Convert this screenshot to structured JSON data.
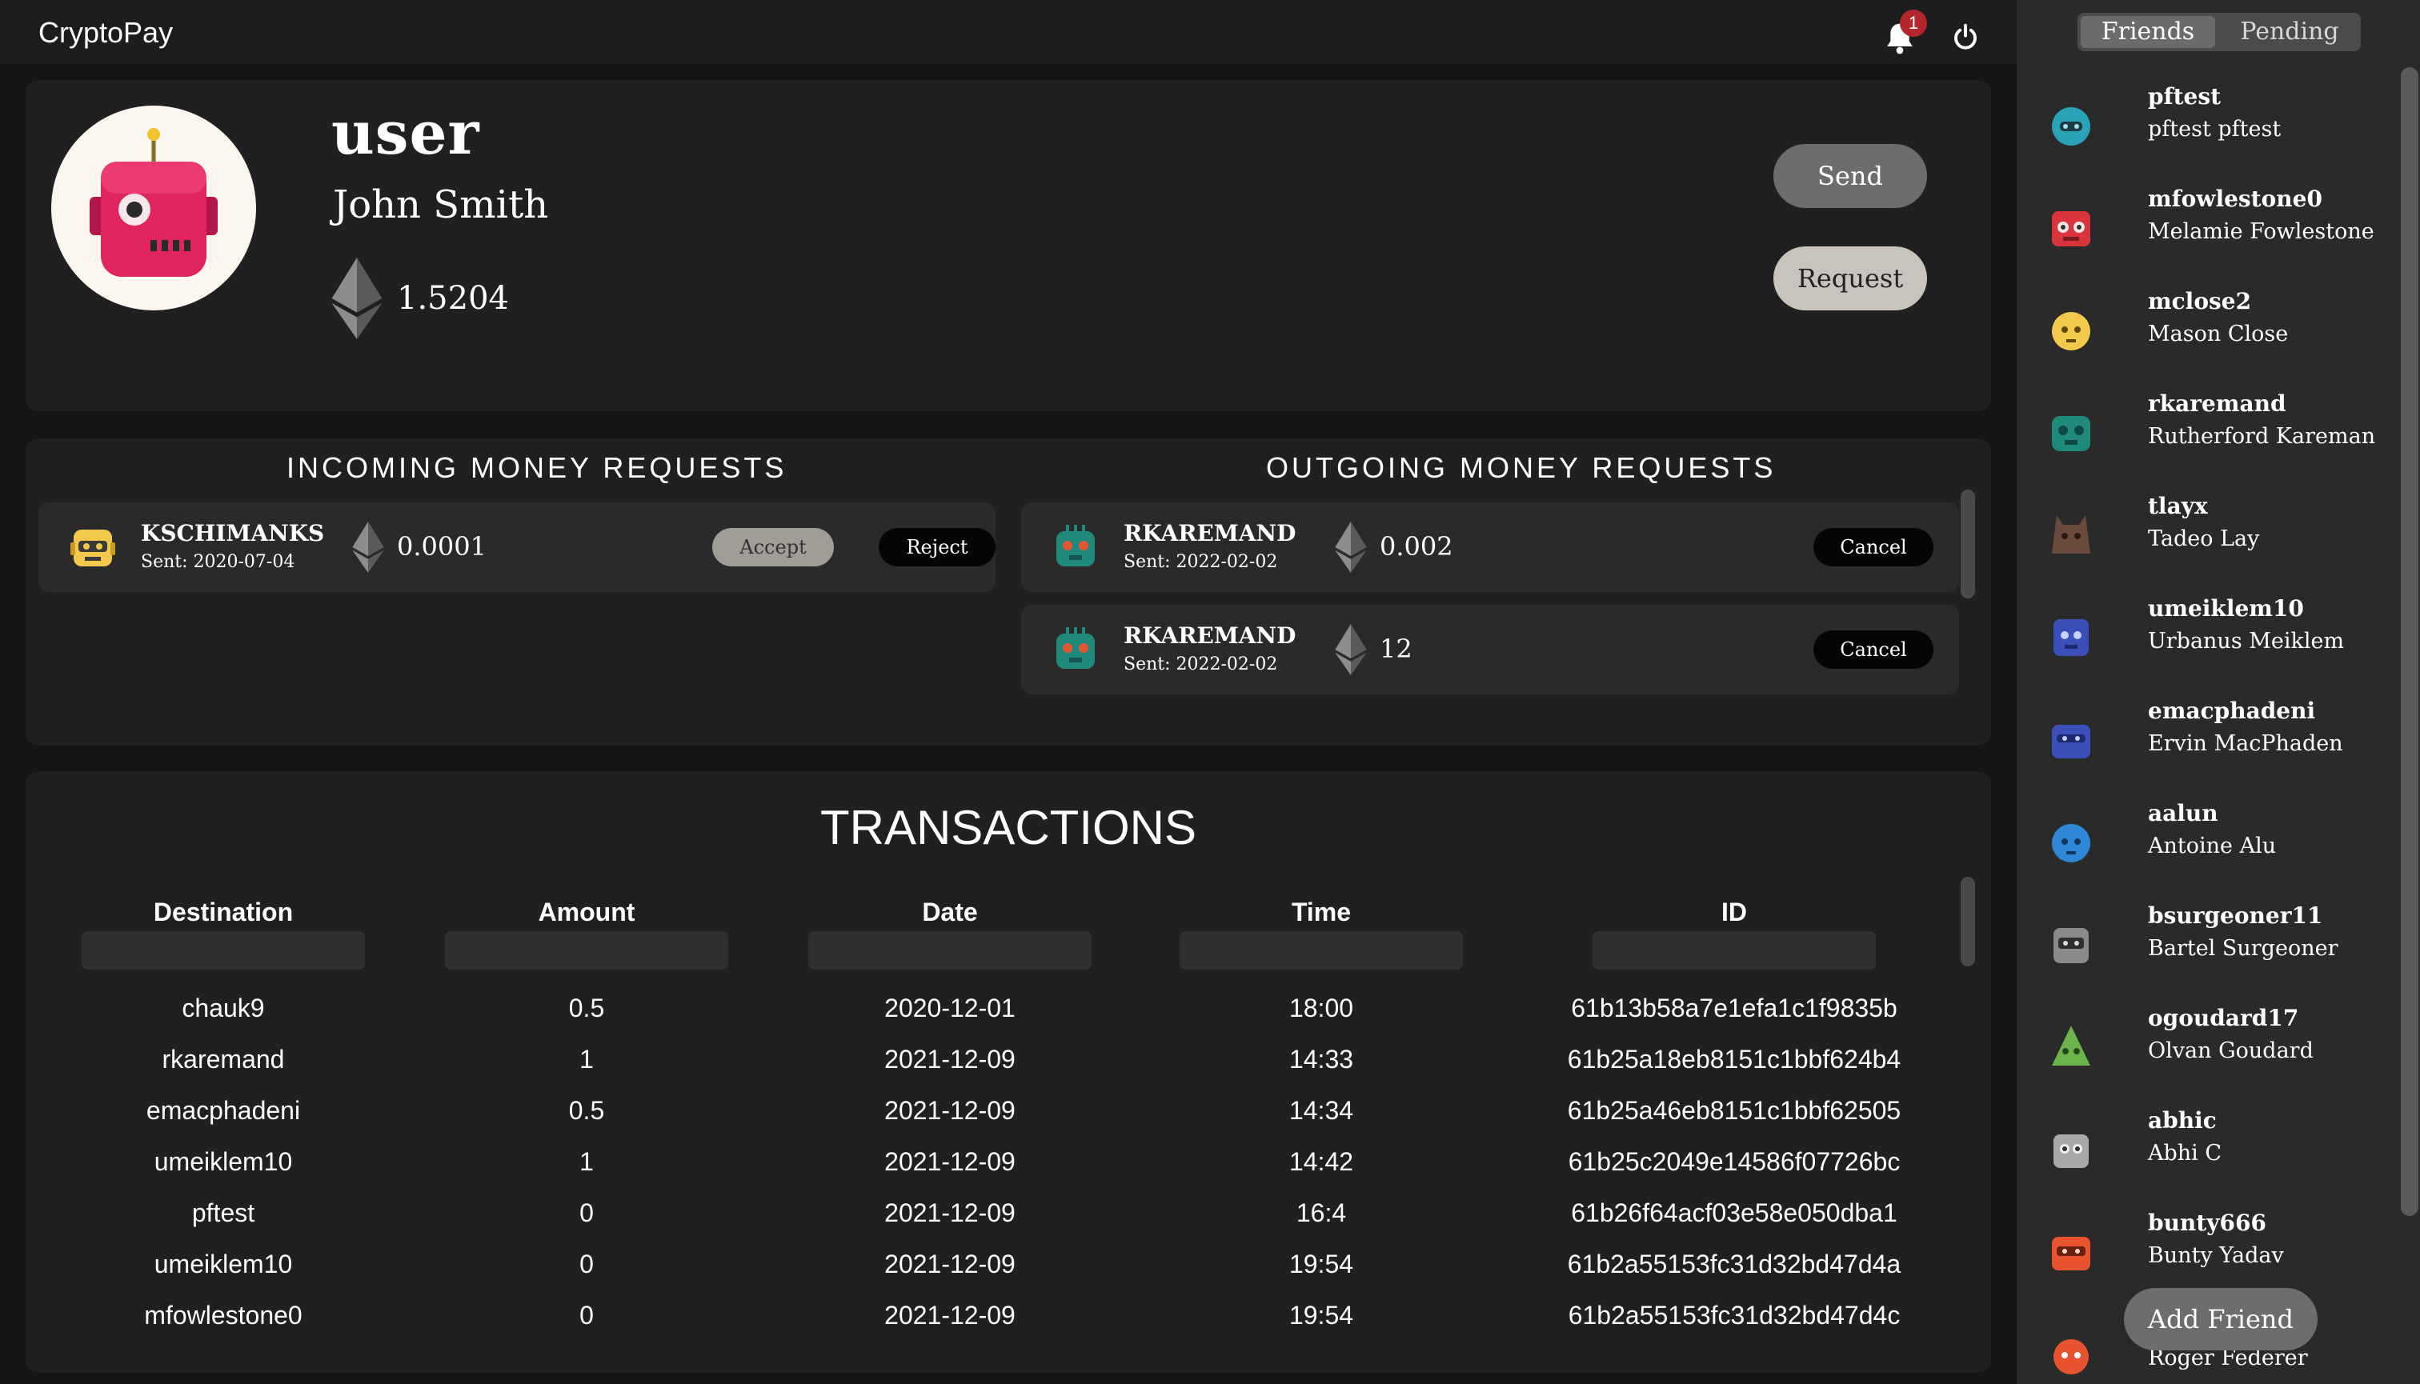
{
  "app": {
    "title": "CryptoPay",
    "notification_count": "1"
  },
  "profile": {
    "username": "user",
    "full_name": "John Smith",
    "balance": "1.5204",
    "send_label": "Send",
    "request_label": "Request"
  },
  "incoming": {
    "heading": "INCOMING MONEY REQUESTS",
    "items": [
      {
        "user": "KSCHIMANKS",
        "sent": "Sent: 2020-07-04",
        "amount": "0.0001",
        "accept_label": "Accept",
        "reject_label": "Reject",
        "avatar_color": "#f2c94c"
      }
    ]
  },
  "outgoing": {
    "heading": "OUTGOING MONEY REQUESTS",
    "items": [
      {
        "user": "RKAREMAND",
        "sent": "Sent: 2022-02-02",
        "amount": "0.002",
        "cancel_label": "Cancel",
        "avatar_color": "#1f8a7a"
      },
      {
        "user": "RKAREMAND",
        "sent": "Sent: 2022-02-02",
        "amount": "12",
        "cancel_label": "Cancel",
        "avatar_color": "#1f8a7a"
      }
    ]
  },
  "transactions": {
    "title": "TRANSACTIONS",
    "columns": [
      "Destination",
      "Amount",
      "Date",
      "Time",
      "ID"
    ],
    "rows": [
      [
        "chauk9",
        "0.5",
        "2020-12-01",
        "18:00",
        "61b13b58a7e1efa1c1f9835b"
      ],
      [
        "rkaremand",
        "1",
        "2021-12-09",
        "14:33",
        "61b25a18eb8151c1bbf624b4"
      ],
      [
        "emacphadeni",
        "0.5",
        "2021-12-09",
        "14:34",
        "61b25a46eb8151c1bbf62505"
      ],
      [
        "umeiklem10",
        "1",
        "2021-12-09",
        "14:42",
        "61b25c2049e14586f07726bc"
      ],
      [
        "pftest",
        "0",
        "2021-12-09",
        "16:4",
        "61b26f64acf03e58e050dba1"
      ],
      [
        "umeiklem10",
        "0",
        "2021-12-09",
        "19:54",
        "61b2a55153fc31d32bd47d4a"
      ],
      [
        "mfowlestone0",
        "0",
        "2021-12-09",
        "19:54",
        "61b2a55153fc31d32bd47d4c"
      ]
    ]
  },
  "sidebar": {
    "tab_friends": "Friends",
    "tab_pending": "Pending",
    "add_friend_label": "Add Friend",
    "friends": [
      {
        "username": "pftest",
        "full_name": "pftest pftest",
        "avatar_color": "#2aa3b8"
      },
      {
        "username": "mfowlestone0",
        "full_name": "Melamie Fowlestone",
        "avatar_color": "#d9343b"
      },
      {
        "username": "mclose2",
        "full_name": "Mason Close",
        "avatar_color": "#f2c94c"
      },
      {
        "username": "rkaremand",
        "full_name": "Rutherford Kareman",
        "avatar_color": "#1f8a7a"
      },
      {
        "username": "tlayx",
        "full_name": "Tadeo Lay",
        "avatar_color": "#6b4a3e"
      },
      {
        "username": "umeiklem10",
        "full_name": "Urbanus Meiklem",
        "avatar_color": "#3a4fb8"
      },
      {
        "username": "emacphadeni",
        "full_name": "Ervin MacPhaden",
        "avatar_color": "#3a4fb8"
      },
      {
        "username": "aalun",
        "full_name": "Antoine Alu",
        "avatar_color": "#2f87d8"
      },
      {
        "username": "bsurgeoner11",
        "full_name": "Bartel Surgeoner",
        "avatar_color": "#8a8a8a"
      },
      {
        "username": "ogoudard17",
        "full_name": "Olvan Goudard",
        "avatar_color": "#6bb34a"
      },
      {
        "username": "abhic",
        "full_name": "Abhi C",
        "avatar_color": "#a9a9a9"
      },
      {
        "username": "bunty666",
        "full_name": "Bunty Yadav",
        "avatar_color": "#e8542f"
      },
      {
        "username": "",
        "full_name": "Roger Federer",
        "avatar_color": "#e8542f"
      }
    ]
  }
}
